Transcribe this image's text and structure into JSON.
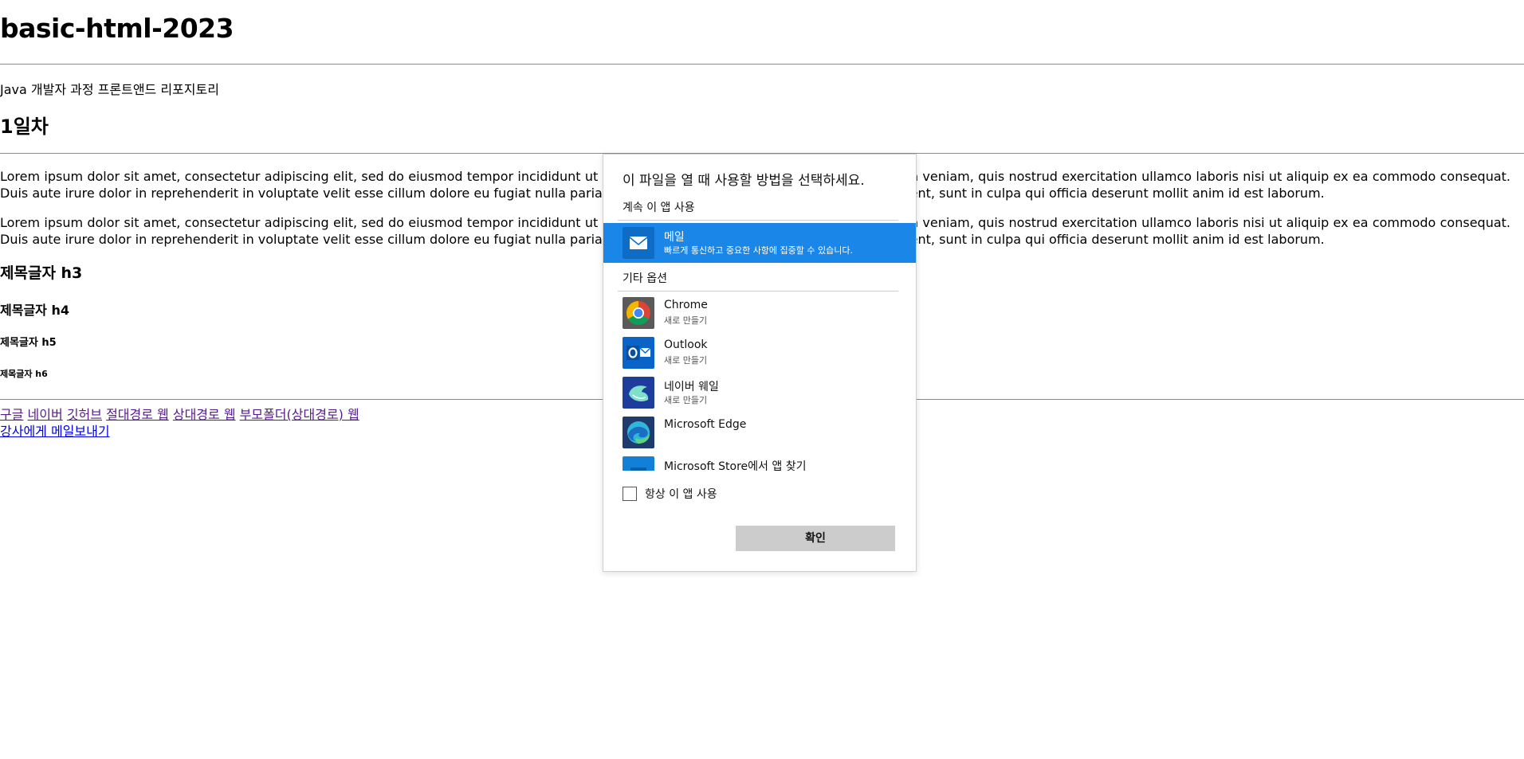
{
  "page": {
    "title": "basic-html-2023",
    "intro": "Java 개발자 과정 프론트앤드 리포지토리",
    "day_heading": "1일차",
    "paragraph1": "Lorem ipsum dolor sit amet, consectetur adipiscing elit, sed do eiusmod tempor incididunt ut labore et dolore magna aliqua. Ut enim ad minim veniam, quis nostrud exercitation ullamco laboris nisi ut aliquip ex ea commodo consequat. Duis aute irure dolor in reprehenderit in voluptate velit esse cillum dolore eu fugiat nulla pariatur. Excepteur sint occaecat cupidatat non proident, sunt in culpa qui officia deserunt mollit anim id est laborum.",
    "paragraph2": "Lorem ipsum dolor sit amet, consectetur adipiscing elit, sed do eiusmod tempor incididunt ut labore et dolore magna aliqua. Ut enim ad minim veniam, quis nostrud exercitation ullamco laboris nisi ut aliquip ex ea commodo consequat. Duis aute irure dolor in reprehenderit in voluptate velit esse cillum dolore eu fugiat nulla pariatur. Excepteur sint occaecat cupidatat non proident, sunt in culpa qui officia deserunt mollit anim id est laborum.",
    "h3": "제목글자 h3",
    "h4": "제목글자 h4",
    "h5": "제목글자 h5",
    "h6": "제목글자 h6",
    "links": {
      "google": "구글",
      "naver": "네이버",
      "github": "깃허브",
      "absolute_web": "절대경로 웹",
      "relative_web": "상대경로 웹",
      "parent_folder_web": "부모폴더(상대경로) 웹",
      "mail_teacher": "강사에게 메일보내기"
    }
  },
  "dialog": {
    "title": "이 파일을 열 때 사용할 방법을 선택하세요.",
    "continue_label": "계속 이 앱 사용",
    "current_app": {
      "name": "메일",
      "description": "빠르게 통신하고 중요한 사항에 집중할 수 있습니다."
    },
    "other_label": "기타 옵션",
    "apps": [
      {
        "name": "Chrome",
        "sub": "새로 만들기",
        "icon": "chrome-icon"
      },
      {
        "name": "Outlook",
        "sub": "새로 만들기",
        "icon": "outlook-icon"
      },
      {
        "name": "네이버 웨일",
        "sub": "새로 만들기",
        "icon": "whale-icon"
      },
      {
        "name": "Microsoft Edge",
        "sub": "",
        "icon": "edge-icon"
      },
      {
        "name": "Microsoft Store에서 앱 찾기",
        "sub": "",
        "icon": "store-icon"
      }
    ],
    "always_use_label": "항상 이 앱 사용",
    "always_use_checked": false,
    "ok_label": "확인",
    "colors": {
      "selection": "#1a86e8",
      "ok_button": "#cccccc"
    }
  }
}
